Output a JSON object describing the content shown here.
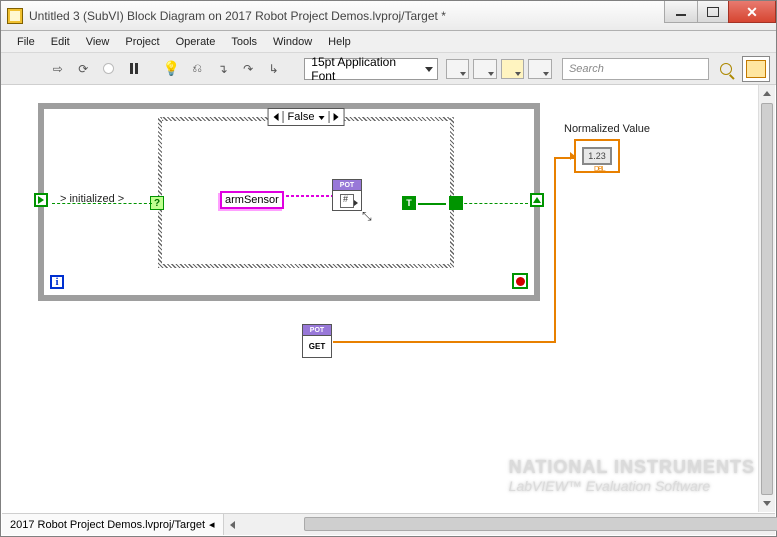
{
  "window": {
    "title": "Untitled 3 (SubVI) Block Diagram on 2017 Robot Project Demos.lvproj/Target *"
  },
  "menu": {
    "file": "File",
    "edit": "Edit",
    "view": "View",
    "project": "Project",
    "operate": "Operate",
    "tools": "Tools",
    "window": "Window",
    "help": "Help"
  },
  "toolbar": {
    "font": "15pt Application Font",
    "search_placeholder": "Search",
    "help": "?"
  },
  "diagram": {
    "case_value": "False",
    "init_label": "> initialized >",
    "refnum_label": "armSensor",
    "pot_header": "POT",
    "true_const": "T",
    "i_terminal": "i",
    "pot_get_header": "POT",
    "pot_get_body": "GET",
    "indicator_label": "Normalized Value",
    "indicator_value": "1.23",
    "indicator_type": "DBL"
  },
  "status": {
    "context": "2017 Robot Project Demos.lvproj/Target"
  },
  "watermark": {
    "line1": "NATIONAL INSTRUMENTS",
    "line2": "LabVIEW™ Evaluation Software"
  }
}
